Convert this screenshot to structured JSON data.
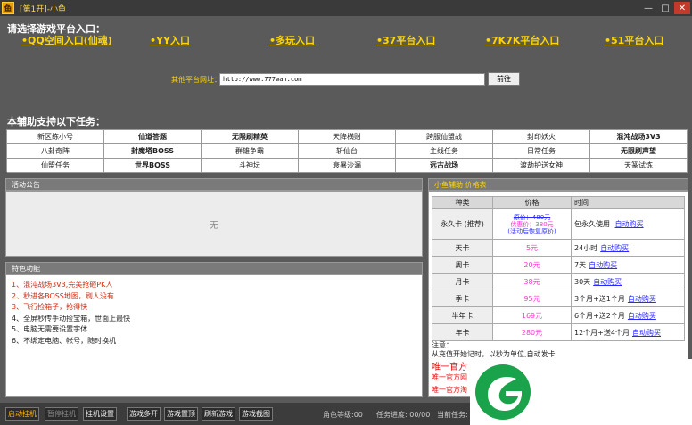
{
  "window": {
    "icon_char": "鱼",
    "title": "[第1开]-小鱼",
    "min_glyph": "—",
    "max_glyph": "□",
    "close_glyph": "✕"
  },
  "platforms": {
    "title": "请选择游戏平台入口：",
    "links": [
      "•QQ空间入口(仙魂)",
      "•YY入口",
      "•多玩入口",
      "•37平台入口",
      "•7K7K平台入口",
      "•51平台入口"
    ]
  },
  "url_bar": {
    "label": "其他平台网址：",
    "value": "http://www.777wan.com",
    "go_label": "前往"
  },
  "tasks": {
    "title": "本辅助支持以下任务：",
    "cells": [
      "新区练小号",
      "仙道答题",
      "无限刷精英",
      "天降横财",
      "跨服仙盟战",
      "封印妖火",
      "混沌战场3V3",
      "八卦奇阵",
      "封魔塔BOSS",
      "群雄争霸",
      "斩仙台",
      "主线任务",
      "日常任务",
      "无限刷声望",
      "仙盟任务",
      "世界BOSS",
      "斗神坛",
      "衰暑沙漏",
      "远古战场",
      "渡劫护送女神",
      "天篆试炼"
    ],
    "bold_cells": [
      1,
      2,
      6,
      8,
      13,
      15,
      18
    ]
  },
  "notice": {
    "header": "活动公告",
    "content": "无"
  },
  "features": {
    "header": "特色功能",
    "lines": [
      {
        "text": "1、混沌战场3V3,完美抢砸PK人",
        "color": "red"
      },
      {
        "text": "2、秒进各BOSS地图，刷人没有",
        "color": "red"
      },
      {
        "text": "3、飞行捡箱子，抢得快",
        "color": "red"
      },
      {
        "text": "4、全屏秒传手动捡宝箱，世面上最快",
        "color": "dark"
      },
      {
        "text": "5、电脑无需要设置字体",
        "color": "dark"
      },
      {
        "text": "6、不绑定电脑、帐号，随时换机",
        "color": "dark"
      }
    ]
  },
  "price": {
    "header": "小鱼辅助 价格表",
    "columns": [
      "种类",
      "价格",
      "时间"
    ],
    "permanent": {
      "kind": "永久卡 (推荐)",
      "orig": "原价：480元",
      "promo": "优惠价：380元",
      "promo_note": "(活动后恢复原价)",
      "time": "包永久使用",
      "buy": "自动购买"
    },
    "rows": [
      {
        "kind": "天卡",
        "price": "5元",
        "time": "24小时",
        "buy": "自动购买"
      },
      {
        "kind": "周卡",
        "price": "20元",
        "time": "7天",
        "buy": "自动购买"
      },
      {
        "kind": "月卡",
        "price": "38元",
        "time": "30天",
        "buy": "自动购买"
      },
      {
        "kind": "季卡",
        "price": "95元",
        "time": "3个月+送1个月",
        "buy": "自动购买"
      },
      {
        "kind": "半年卡",
        "price": "169元",
        "time": "6个月+送2个月",
        "buy": "自动购买"
      },
      {
        "kind": "年卡",
        "price": "280元",
        "time": "12个月+送4个月",
        "buy": "自动购买"
      }
    ],
    "note_title": "注意：",
    "note_text": "从充值开始记时，以秒为单位,自动发卡",
    "official_1": "唯一官方",
    "official_2": "唯一官方网",
    "official_3": "唯一官方淘"
  },
  "bottombar": {
    "buttons": [
      "启动挂机",
      "暂停挂机",
      "挂机设置",
      "游戏多开",
      "游戏置顶",
      "刷新游戏",
      "游戏截图"
    ],
    "level": "角色等级:00",
    "progress": "任务进度: 00/00",
    "current": "当前任务:"
  }
}
